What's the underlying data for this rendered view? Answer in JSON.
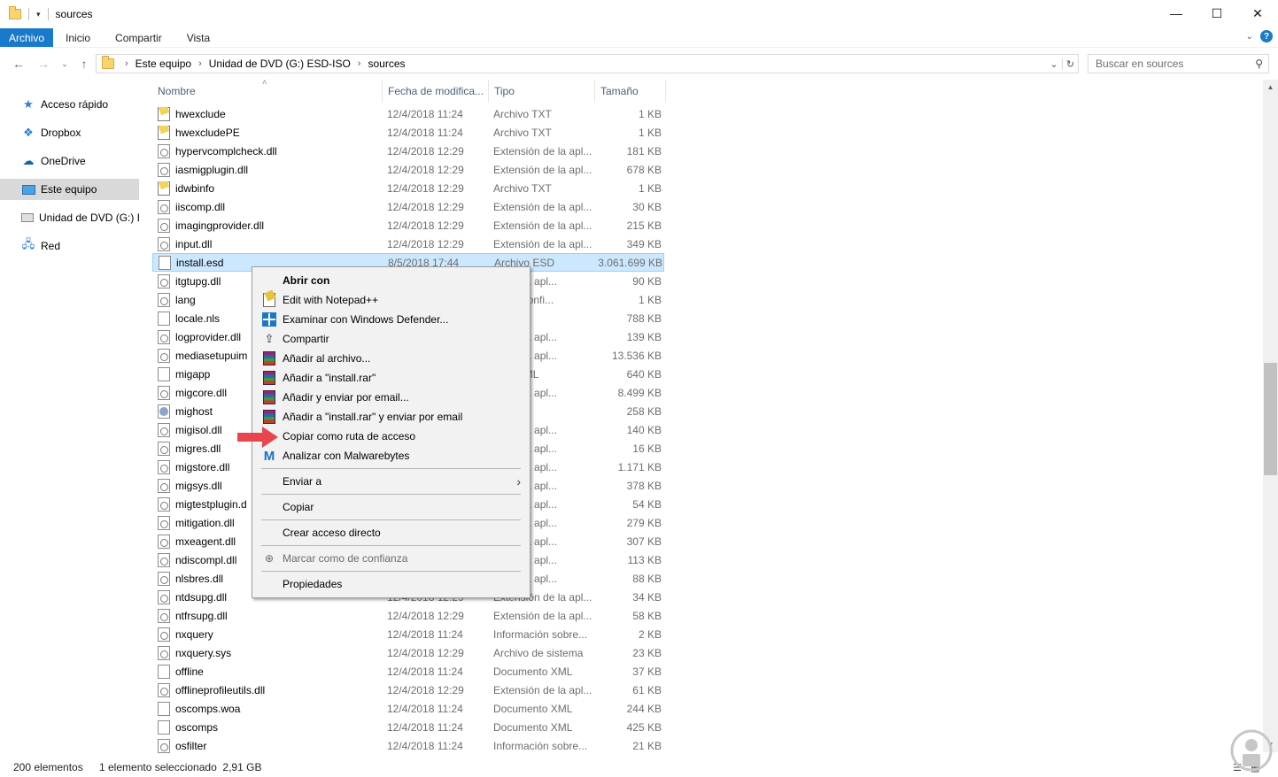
{
  "window": {
    "title": "sources"
  },
  "ribbon": {
    "tabs": [
      {
        "label": "Archivo",
        "active": true
      },
      {
        "label": "Inicio"
      },
      {
        "label": "Compartir"
      },
      {
        "label": "Vista"
      }
    ]
  },
  "address": {
    "crumbs": [
      "Este equipo",
      "Unidad de DVD (G:) ESD-ISO",
      "sources"
    ]
  },
  "search": {
    "placeholder": "Buscar en sources"
  },
  "nav": {
    "items": [
      {
        "label": "Acceso rápido",
        "icon": "star-icon"
      },
      {
        "label": "Dropbox",
        "icon": "dropbox-icon"
      },
      {
        "label": "OneDrive",
        "icon": "cloud-icon"
      },
      {
        "label": "Este equipo",
        "icon": "computer-icon",
        "selected": true
      },
      {
        "label": "Unidad de DVD (G:) E",
        "icon": "dvd-drive-icon"
      },
      {
        "label": "Red",
        "icon": "network-icon"
      }
    ]
  },
  "columns": {
    "name": "Nombre",
    "date": "Fecha de modifica...",
    "type": "Tipo",
    "size": "Tamaño"
  },
  "files": [
    {
      "name": "hwexclude",
      "date": "12/4/2018 11:24",
      "type": "Archivo TXT",
      "size": "1 KB",
      "icon": "txt"
    },
    {
      "name": "hwexcludePE",
      "date": "12/4/2018 11:24",
      "type": "Archivo TXT",
      "size": "1 KB",
      "icon": "txt"
    },
    {
      "name": "hypervcomplcheck.dll",
      "date": "12/4/2018 12:29",
      "type": "Extensión de la apl...",
      "size": "181 KB",
      "icon": "dll"
    },
    {
      "name": "iasmigplugin.dll",
      "date": "12/4/2018 12:29",
      "type": "Extensión de la apl...",
      "size": "678 KB",
      "icon": "dll"
    },
    {
      "name": "idwbinfo",
      "date": "12/4/2018 12:29",
      "type": "Archivo TXT",
      "size": "1 KB",
      "icon": "txt"
    },
    {
      "name": "iiscomp.dll",
      "date": "12/4/2018 12:29",
      "type": "Extensión de la apl...",
      "size": "30 KB",
      "icon": "dll"
    },
    {
      "name": "imagingprovider.dll",
      "date": "12/4/2018 12:29",
      "type": "Extensión de la apl...",
      "size": "215 KB",
      "icon": "dll"
    },
    {
      "name": "input.dll",
      "date": "12/4/2018 12:29",
      "type": "Extensión de la apl...",
      "size": "349 KB",
      "icon": "dll"
    },
    {
      "name": "install.esd",
      "date": "8/5/2018 17:44",
      "type": "Archivo ESD",
      "size": "3.061.699 KB",
      "icon": "file",
      "selected": true
    },
    {
      "name": "itgtupg.dll",
      "date": "",
      "type": "on de la apl...",
      "size": "90 KB",
      "icon": "dll"
    },
    {
      "name": "lang",
      "date": "",
      "type": "es de confi...",
      "size": "1 KB",
      "icon": "dll"
    },
    {
      "name": "locale.nls",
      "date": "",
      "type": "NLS",
      "size": "788 KB",
      "icon": "file"
    },
    {
      "name": "logprovider.dll",
      "date": "",
      "type": "on de la apl...",
      "size": "139 KB",
      "icon": "dll"
    },
    {
      "name": "mediasetupuim",
      "date": "",
      "type": "on de la apl...",
      "size": "13.536 KB",
      "icon": "dll"
    },
    {
      "name": "migapp",
      "date": "",
      "type": "ento XML",
      "size": "640 KB",
      "icon": "file"
    },
    {
      "name": "migcore.dll",
      "date": "",
      "type": "on de la apl...",
      "size": "8.499 KB",
      "icon": "dll"
    },
    {
      "name": "mighost",
      "date": "",
      "type": "ión",
      "size": "258 KB",
      "icon": "exe"
    },
    {
      "name": "migisol.dll",
      "date": "",
      "type": "on de la apl...",
      "size": "140 KB",
      "icon": "dll"
    },
    {
      "name": "migres.dll",
      "date": "",
      "type": "on de la apl...",
      "size": "16 KB",
      "icon": "dll"
    },
    {
      "name": "migstore.dll",
      "date": "",
      "type": "on de la apl...",
      "size": "1.171 KB",
      "icon": "dll"
    },
    {
      "name": "migsys.dll",
      "date": "",
      "type": "on de la apl...",
      "size": "378 KB",
      "icon": "dll"
    },
    {
      "name": "migtestplugin.d",
      "date": "",
      "type": "on de la apl...",
      "size": "54 KB",
      "icon": "dll"
    },
    {
      "name": "mitigation.dll",
      "date": "",
      "type": "on de la apl...",
      "size": "279 KB",
      "icon": "dll"
    },
    {
      "name": "mxeagent.dll",
      "date": "",
      "type": "on de la apl...",
      "size": "307 KB",
      "icon": "dll"
    },
    {
      "name": "ndiscompl.dll",
      "date": "",
      "type": "on de la apl...",
      "size": "113 KB",
      "icon": "dll"
    },
    {
      "name": "nlsbres.dll",
      "date": "",
      "type": "on de la apl...",
      "size": "88 KB",
      "icon": "dll"
    },
    {
      "name": "ntdsupg.dll",
      "date": "12/4/2018 12:29",
      "type": "Extensión de la apl...",
      "size": "34 KB",
      "icon": "dll"
    },
    {
      "name": "ntfrsupg.dll",
      "date": "12/4/2018 12:29",
      "type": "Extensión de la apl...",
      "size": "58 KB",
      "icon": "dll"
    },
    {
      "name": "nxquery",
      "date": "12/4/2018 11:24",
      "type": "Información sobre...",
      "size": "2 KB",
      "icon": "dll"
    },
    {
      "name": "nxquery.sys",
      "date": "12/4/2018 12:29",
      "type": "Archivo de sistema",
      "size": "23 KB",
      "icon": "dll"
    },
    {
      "name": "offline",
      "date": "12/4/2018 11:24",
      "type": "Documento XML",
      "size": "37 KB",
      "icon": "file"
    },
    {
      "name": "offlineprofileutils.dll",
      "date": "12/4/2018 12:29",
      "type": "Extensión de la apl...",
      "size": "61 KB",
      "icon": "dll"
    },
    {
      "name": "oscomps.woa",
      "date": "12/4/2018 11:24",
      "type": "Documento XML",
      "size": "244 KB",
      "icon": "file"
    },
    {
      "name": "oscomps",
      "date": "12/4/2018 11:24",
      "type": "Documento XML",
      "size": "425 KB",
      "icon": "file"
    },
    {
      "name": "osfilter",
      "date": "12/4/2018 11:24",
      "type": "Información sobre...",
      "size": "21 KB",
      "icon": "dll"
    }
  ],
  "context_menu": {
    "items": [
      {
        "label": "Abrir con",
        "bold": true,
        "icon": ""
      },
      {
        "label": "Edit with Notepad++",
        "icon": "notepadpp-icon"
      },
      {
        "label": "Examinar con Windows Defender...",
        "icon": "defender-icon"
      },
      {
        "label": "Compartir",
        "icon": "share-icon"
      },
      {
        "label": "Añadir al archivo...",
        "icon": "winrar-icon"
      },
      {
        "label": "Añadir a \"install.rar\"",
        "icon": "winrar-icon"
      },
      {
        "label": "Añadir y enviar por email...",
        "icon": "winrar-icon"
      },
      {
        "label": "Añadir a \"install.rar\" y enviar por email",
        "icon": "winrar-icon"
      },
      {
        "label": "Copiar como ruta de acceso",
        "icon": ""
      },
      {
        "label": "Analizar con Malwarebytes",
        "icon": "malwarebytes-icon"
      },
      {
        "label": "Enviar a",
        "submenu": true,
        "icon": ""
      },
      {
        "label": "Copiar",
        "icon": ""
      },
      {
        "label": "Crear acceso directo",
        "icon": ""
      },
      {
        "label": "Marcar como de confianza",
        "disabled": true,
        "icon": "trust-icon"
      },
      {
        "label": "Propiedades",
        "icon": ""
      }
    ]
  },
  "status": {
    "count": "200 elementos",
    "selection": "1 elemento seleccionado  2,91 GB"
  },
  "colors": {
    "accent": "#1979ca",
    "selection_bg": "#cce8ff",
    "arrow": "#e8464e"
  }
}
